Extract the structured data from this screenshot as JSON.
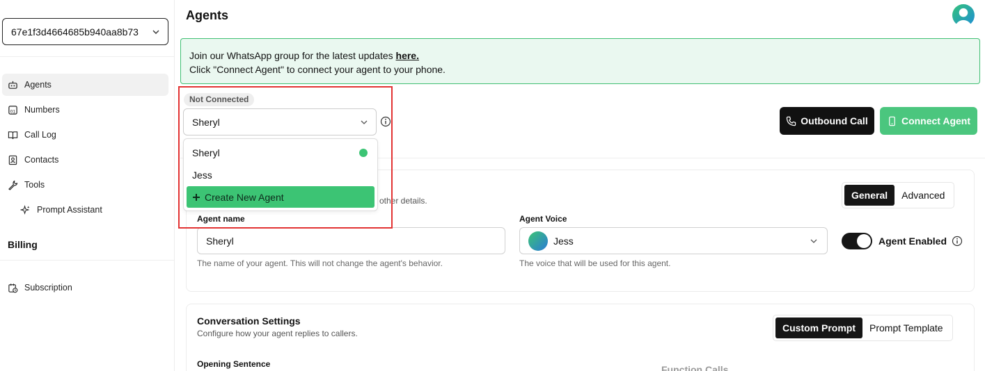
{
  "sidebar": {
    "org_id": "67e1f3d4664685b940aa8b73",
    "nav": [
      {
        "label": "Agents",
        "icon": "bot-icon"
      },
      {
        "label": "Numbers",
        "icon": "dialpad-icon"
      },
      {
        "label": "Call Log",
        "icon": "book-icon"
      },
      {
        "label": "Contacts",
        "icon": "contact-icon"
      },
      {
        "label": "Tools",
        "icon": "wrench-icon"
      },
      {
        "label": "Prompt Assistant",
        "icon": "sparkles-icon"
      }
    ],
    "billing_title": "Billing",
    "subscription": "Subscription"
  },
  "header": {
    "title": "Agents"
  },
  "banner": {
    "line1_prefix": "Join our WhatsApp group for the latest updates ",
    "line1_link": "here.",
    "line2": "Click \"Connect Agent\" to connect your agent to your phone."
  },
  "agent_selector": {
    "status": "Not Connected",
    "selected": "Sheryl",
    "options": [
      "Sheryl",
      "Jess"
    ],
    "create_label": "Create New Agent",
    "active_color": "#3cc474"
  },
  "actions": {
    "outbound_call": "Outbound Call",
    "connect_agent": "Connect Agent"
  },
  "agent_card": {
    "subtext": "other details.",
    "tabs": [
      "General",
      "Advanced"
    ],
    "agent_name_label": "Agent name",
    "agent_name_value": "Sheryl",
    "agent_name_help": "The name of your agent. This will not change the agent's behavior.",
    "voice_label": "Agent Voice",
    "voice_value": "Jess",
    "voice_help": "The voice that will be used for this agent.",
    "enabled_label": "Agent Enabled"
  },
  "conversation": {
    "title": "Conversation Settings",
    "subtitle": "Configure how your agent replies to callers.",
    "tabs": [
      "Custom Prompt",
      "Prompt Template"
    ],
    "opening_label": "Opening Sentence",
    "function_calls_label": "Function Calls"
  },
  "colors": {
    "accent": "#3cc474",
    "dark": "#111111",
    "banner_bg": "#eaf8f0",
    "highlight": "#e23232"
  }
}
